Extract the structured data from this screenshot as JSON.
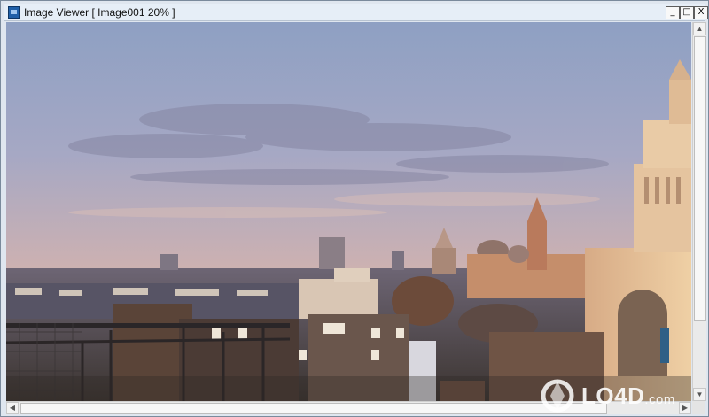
{
  "window": {
    "title": "Image Viewer [ Image001 20% ]",
    "controls": {
      "minimize": "_",
      "maximize": "□",
      "close": "X"
    }
  },
  "image": {
    "subject": "city-skyline-sunset"
  },
  "scrollbars": {
    "up": "▲",
    "down": "▼",
    "left": "◀",
    "right": "▶"
  },
  "watermark": {
    "text": "LO4D",
    "suffix": ".com"
  },
  "colors": {
    "titlebar": "#e6eef7",
    "sky_top": "#8fa0c2",
    "sky_bottom": "#d8b9a6",
    "buildings_lit": "#e6c39a"
  }
}
